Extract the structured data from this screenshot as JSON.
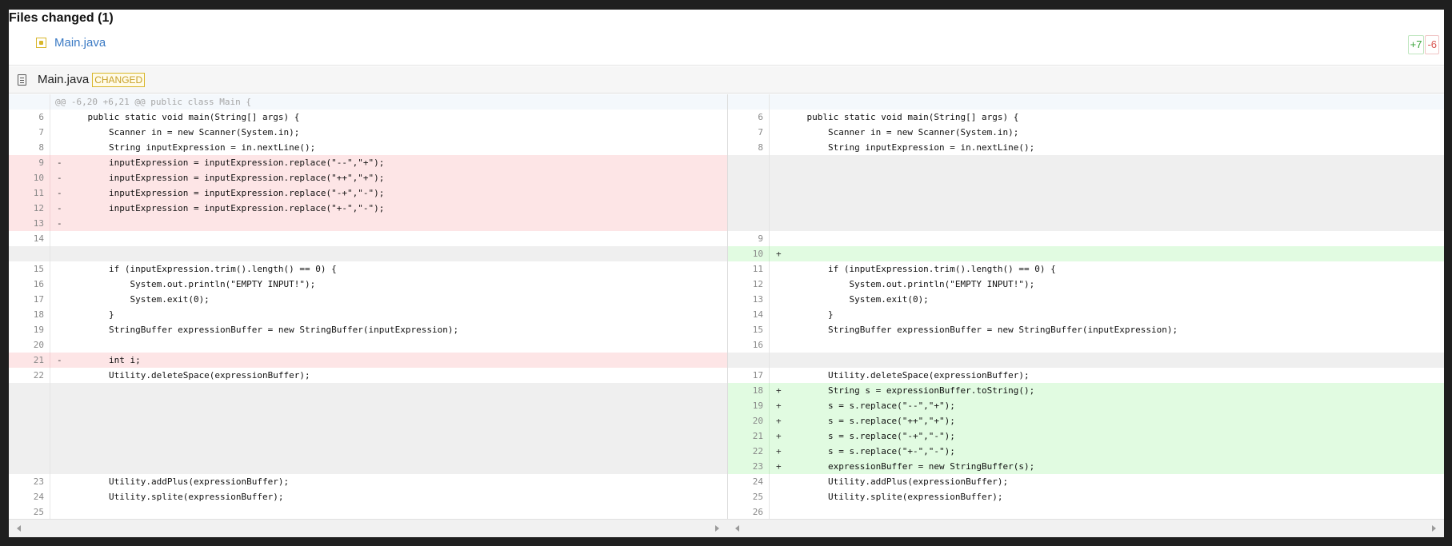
{
  "files_changed": {
    "title": "Files changed (1)",
    "file_name": "Main.java",
    "additions": "+7",
    "deletions": "-6"
  },
  "diff_header": {
    "file_name": "Main.java",
    "status": "CHANGED"
  },
  "hunk_header": "@@ -6,20 +6,21 @@ public class Main {",
  "left_lines": [
    {
      "type": "hunk",
      "n": "",
      "m": "",
      "code": ""
    },
    {
      "type": "ctx",
      "n": "6",
      "m": "",
      "code": "    public static void main(String[] args) {"
    },
    {
      "type": "ctx",
      "n": "7",
      "m": "",
      "code": "        Scanner in = new Scanner(System.in);"
    },
    {
      "type": "ctx",
      "n": "8",
      "m": "",
      "code": "        String inputExpression = in.nextLine();"
    },
    {
      "type": "del",
      "n": "9",
      "m": "-",
      "code": "        inputExpression = inputExpression.replace(\"--\",\"+\");"
    },
    {
      "type": "del",
      "n": "10",
      "m": "-",
      "code": "        inputExpression = inputExpression.replace(\"++\",\"+\");"
    },
    {
      "type": "del",
      "n": "11",
      "m": "-",
      "code": "        inputExpression = inputExpression.replace(\"-+\",\"-\");"
    },
    {
      "type": "del",
      "n": "12",
      "m": "-",
      "code": "        inputExpression = inputExpression.replace(\"+-\",\"-\");"
    },
    {
      "type": "del",
      "n": "13",
      "m": "-",
      "code": ""
    },
    {
      "type": "ctx",
      "n": "14",
      "m": "",
      "code": ""
    },
    {
      "type": "empty",
      "n": "",
      "m": "",
      "code": ""
    },
    {
      "type": "ctx",
      "n": "15",
      "m": "",
      "code": "        if (inputExpression.trim().length() == 0) {"
    },
    {
      "type": "ctx",
      "n": "16",
      "m": "",
      "code": "            System.out.println(\"EMPTY INPUT!\");"
    },
    {
      "type": "ctx",
      "n": "17",
      "m": "",
      "code": "            System.exit(0);"
    },
    {
      "type": "ctx",
      "n": "18",
      "m": "",
      "code": "        }"
    },
    {
      "type": "ctx",
      "n": "19",
      "m": "",
      "code": "        StringBuffer expressionBuffer = new StringBuffer(inputExpression);"
    },
    {
      "type": "ctx",
      "n": "20",
      "m": "",
      "code": ""
    },
    {
      "type": "del",
      "n": "21",
      "m": "-",
      "code": "        int i;"
    },
    {
      "type": "ctx",
      "n": "22",
      "m": "",
      "code": "        Utility.deleteSpace(expressionBuffer);"
    },
    {
      "type": "empty",
      "n": "",
      "m": "",
      "code": ""
    },
    {
      "type": "empty",
      "n": "",
      "m": "",
      "code": ""
    },
    {
      "type": "empty",
      "n": "",
      "m": "",
      "code": ""
    },
    {
      "type": "empty",
      "n": "",
      "m": "",
      "code": ""
    },
    {
      "type": "empty",
      "n": "",
      "m": "",
      "code": ""
    },
    {
      "type": "empty",
      "n": "",
      "m": "",
      "code": ""
    },
    {
      "type": "ctx",
      "n": "23",
      "m": "",
      "code": "        Utility.addPlus(expressionBuffer);"
    },
    {
      "type": "ctx",
      "n": "24",
      "m": "",
      "code": "        Utility.splite(expressionBuffer);"
    },
    {
      "type": "ctx",
      "n": "25",
      "m": "",
      "code": ""
    }
  ],
  "right_lines": [
    {
      "type": "hunk",
      "n": "",
      "m": "",
      "code": ""
    },
    {
      "type": "ctx",
      "n": "6",
      "m": "",
      "code": "    public static void main(String[] args) {"
    },
    {
      "type": "ctx",
      "n": "7",
      "m": "",
      "code": "        Scanner in = new Scanner(System.in);"
    },
    {
      "type": "ctx",
      "n": "8",
      "m": "",
      "code": "        String inputExpression = in.nextLine();"
    },
    {
      "type": "empty",
      "n": "",
      "m": "",
      "code": ""
    },
    {
      "type": "empty",
      "n": "",
      "m": "",
      "code": ""
    },
    {
      "type": "empty",
      "n": "",
      "m": "",
      "code": ""
    },
    {
      "type": "empty",
      "n": "",
      "m": "",
      "code": ""
    },
    {
      "type": "empty",
      "n": "",
      "m": "",
      "code": ""
    },
    {
      "type": "ctx",
      "n": "9",
      "m": "",
      "code": ""
    },
    {
      "type": "add",
      "n": "10",
      "m": "+",
      "code": ""
    },
    {
      "type": "ctx",
      "n": "11",
      "m": "",
      "code": "        if (inputExpression.trim().length() == 0) {"
    },
    {
      "type": "ctx",
      "n": "12",
      "m": "",
      "code": "            System.out.println(\"EMPTY INPUT!\");"
    },
    {
      "type": "ctx",
      "n": "13",
      "m": "",
      "code": "            System.exit(0);"
    },
    {
      "type": "ctx",
      "n": "14",
      "m": "",
      "code": "        }"
    },
    {
      "type": "ctx",
      "n": "15",
      "m": "",
      "code": "        StringBuffer expressionBuffer = new StringBuffer(inputExpression);"
    },
    {
      "type": "ctx",
      "n": "16",
      "m": "",
      "code": ""
    },
    {
      "type": "empty",
      "n": "",
      "m": "",
      "code": ""
    },
    {
      "type": "ctx",
      "n": "17",
      "m": "",
      "code": "        Utility.deleteSpace(expressionBuffer);"
    },
    {
      "type": "add",
      "n": "18",
      "m": "+",
      "code": "        String s = expressionBuffer.toString();"
    },
    {
      "type": "add",
      "n": "19",
      "m": "+",
      "code": "        s = s.replace(\"--\",\"+\");"
    },
    {
      "type": "add",
      "n": "20",
      "m": "+",
      "code": "        s = s.replace(\"++\",\"+\");"
    },
    {
      "type": "add",
      "n": "21",
      "m": "+",
      "code": "        s = s.replace(\"-+\",\"-\");"
    },
    {
      "type": "add",
      "n": "22",
      "m": "+",
      "code": "        s = s.replace(\"+-\",\"-\");"
    },
    {
      "type": "add",
      "n": "23",
      "m": "+",
      "code": "        expressionBuffer = new StringBuffer(s);"
    },
    {
      "type": "ctx",
      "n": "24",
      "m": "",
      "code": "        Utility.addPlus(expressionBuffer);"
    },
    {
      "type": "ctx",
      "n": "25",
      "m": "",
      "code": "        Utility.splite(expressionBuffer);"
    },
    {
      "type": "ctx",
      "n": "26",
      "m": "",
      "code": ""
    }
  ],
  "colors": {
    "deleted_bg": "#fde5e6",
    "added_bg": "#e1fbe1",
    "empty_bg": "#efefef",
    "link": "#3b7ac4",
    "additions": "#3aa33a",
    "deletions": "#d9534f",
    "changed_badge": "#d8b62a"
  },
  "icons": {
    "file_status": "modified-square-icon",
    "diff_file": "document-icon",
    "scroll_left": "scroll-left-arrow-icon",
    "scroll_right": "scroll-right-arrow-icon"
  }
}
